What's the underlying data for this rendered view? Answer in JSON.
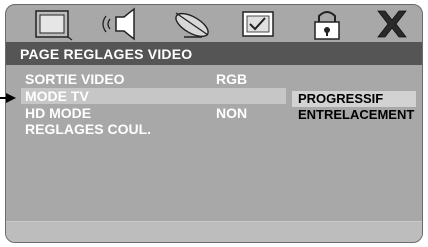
{
  "title": "PAGE REGLAGES VIDEO",
  "tabs": [
    {
      "icon": "tv-screen-icon"
    },
    {
      "icon": "speaker-audio-icon"
    },
    {
      "icon": "satellite-dish-icon"
    },
    {
      "icon": "checklist-icon"
    },
    {
      "icon": "padlock-icon"
    },
    {
      "icon": "close-x-icon"
    }
  ],
  "menu": [
    {
      "label": "SORTIE VIDEO",
      "value": "RGB"
    },
    {
      "label": "MODE TV",
      "value": ""
    },
    {
      "label": "HD MODE",
      "value": "NON"
    },
    {
      "label": "REGLAGES COUL.",
      "value": ""
    }
  ],
  "submenu": [
    "PROGRESSIF",
    "ENTRELACEMENT"
  ],
  "colors": {
    "panel": "#a8a8a8",
    "title_bar": "#555555",
    "highlight": "#c6c6c6",
    "close_x": "#2a2a2a"
  }
}
